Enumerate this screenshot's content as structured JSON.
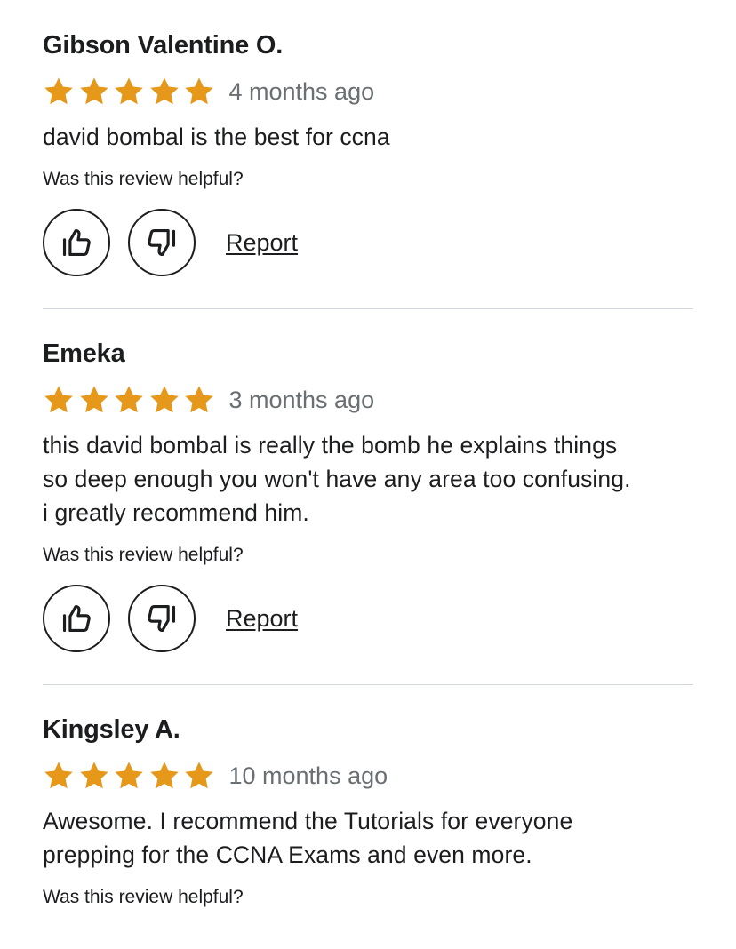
{
  "colors": {
    "star": "#e59819",
    "text": "#1c1d1f",
    "muted": "#6a6f73",
    "divider": "#d1d7dc"
  },
  "icons": {
    "star": "star-icon",
    "thumbs_up": "thumbs-up-icon",
    "thumbs_down": "thumbs-down-icon"
  },
  "reviews": [
    {
      "name": "Gibson Valentine O.",
      "rating": 5,
      "date": "4 months ago",
      "text_lines": [
        "david bombal is the best for ccna"
      ],
      "helpful_prompt": "Was this review helpful?",
      "report_label": "Report"
    },
    {
      "name": "Emeka",
      "rating": 5,
      "date": "3 months ago",
      "text_lines": [
        "this david bombal is really the bomb he explains things",
        "so deep enough you won't have any area too confusing.",
        "i greatly recommend him."
      ],
      "helpful_prompt": "Was this review helpful?",
      "report_label": "Report"
    },
    {
      "name": "Kingsley A.",
      "rating": 5,
      "date": "10 months ago",
      "text_lines": [
        "Awesome. I recommend the Tutorials for everyone",
        "prepping for the CCNA Exams and even more."
      ],
      "helpful_prompt": "Was this review helpful?"
    }
  ]
}
